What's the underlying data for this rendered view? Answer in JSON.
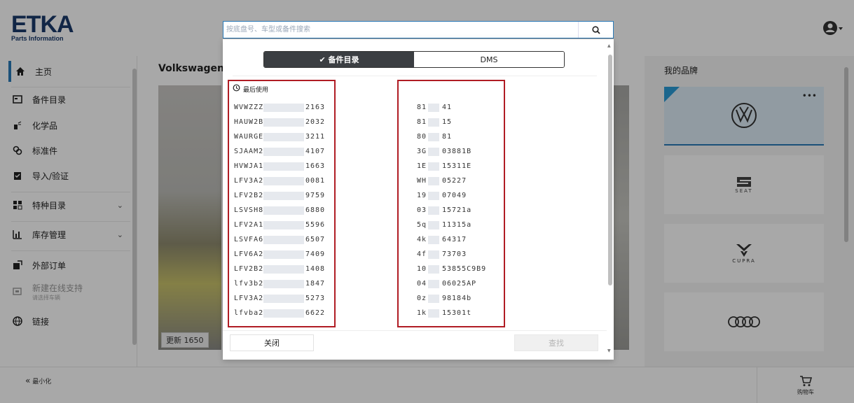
{
  "app": {
    "logo_main": "ETKA",
    "logo_sub": "Parts Information"
  },
  "search": {
    "placeholder": "按底盘号、车型或备件搜索"
  },
  "sidebar": {
    "items": [
      {
        "label": "主页",
        "icon": "home-icon"
      },
      {
        "label": "备件目录",
        "icon": "catalog-icon"
      },
      {
        "label": "化学品",
        "icon": "chemical-icon"
      },
      {
        "label": "标准件",
        "icon": "standard-parts-icon"
      },
      {
        "label": "导入/验证",
        "icon": "clipboard-icon"
      },
      {
        "label": "特种目录",
        "icon": "special-catalog-icon"
      },
      {
        "label": "库存管理",
        "icon": "inventory-icon"
      },
      {
        "label": "外部订单",
        "icon": "external-order-icon"
      },
      {
        "label": "新建在线支持",
        "icon": "support-icon",
        "sub": "请选择车辆"
      },
      {
        "label": "链接",
        "icon": "globe-icon"
      }
    ],
    "minimize_label": "最小化"
  },
  "main": {
    "brand_title": "Volkswagen",
    "update_label": "更新 1650"
  },
  "right_panel": {
    "title": "我的品牌",
    "brands": [
      "Volkswagen",
      "SEAT",
      "CUPRA",
      "Audi"
    ],
    "seat_text": "SEAT",
    "cupra_text": "CUPRA"
  },
  "cart": {
    "label": "购物车"
  },
  "dropdown": {
    "tabs": [
      {
        "label": "✔ 备件目录",
        "active": true
      },
      {
        "label": "DMS",
        "active": false
      }
    ],
    "recent_label": "最后使用",
    "vins": [
      {
        "start": "WVWZZZ",
        "end": "2163"
      },
      {
        "start": "HAUW2B",
        "end": "2032"
      },
      {
        "start": "WAURGE",
        "end": "3211"
      },
      {
        "start": "SJAAM2",
        "end": "4107"
      },
      {
        "start": "HVWJA1",
        "end": "1663"
      },
      {
        "start": "LFV3A2",
        "end": "0081"
      },
      {
        "start": "LFV2B2",
        "end": "9759"
      },
      {
        "start": "LSVSH8",
        "end": "6880"
      },
      {
        "start": "LFV2A1",
        "end": "5596"
      },
      {
        "start": "LSVFA6",
        "end": "6507"
      },
      {
        "start": "LFV6A2",
        "end": "7409"
      },
      {
        "start": "LFV2B2",
        "end": "1408"
      },
      {
        "start": "lfv3b2",
        "end": "1847"
      },
      {
        "start": "LFV3A2",
        "end": "5273"
      },
      {
        "start": "lfvba2.",
        "end": "6622"
      }
    ],
    "parts": [
      {
        "start": "81",
        "end": "41"
      },
      {
        "start": "81",
        "end": "15"
      },
      {
        "start": "80",
        "end": "81"
      },
      {
        "start": "3G",
        "end": "03881B"
      },
      {
        "start": "1E",
        "end": "15311E"
      },
      {
        "start": "WH",
        "end": "05227"
      },
      {
        "start": "19",
        "end": "07049"
      },
      {
        "start": "03",
        "end": "15721a"
      },
      {
        "start": "5q",
        "end": "11315a"
      },
      {
        "start": "4k",
        "end": "64317"
      },
      {
        "start": "4f",
        "end": "73703"
      },
      {
        "start": "10",
        "end": "53855C9B9"
      },
      {
        "start": "04",
        "end": "06025AP"
      },
      {
        "start": "0z",
        "end": "98184b"
      },
      {
        "start": "1k",
        "end": "15301t"
      }
    ],
    "close_label": "关闭",
    "find_label": "查找"
  }
}
